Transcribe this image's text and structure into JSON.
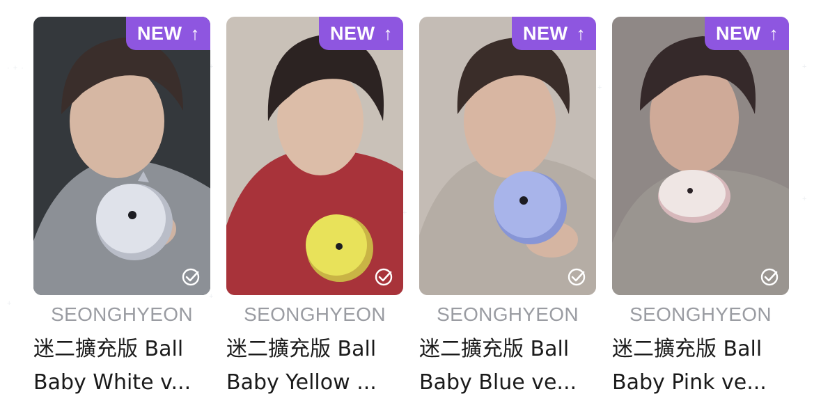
{
  "cards": [
    {
      "badge": "NEW",
      "member": "SEONGHYEON",
      "title_line1": "迷二擴充版 Ball",
      "title_line2": "Baby White v...",
      "colors": {
        "bg": "#34383c",
        "shirt": "#8c9096",
        "plush": "#dfe2ea",
        "plush_shadow": "#b9bdc8",
        "skin": "#d6b7a3",
        "hair": "#3a2e2b"
      }
    },
    {
      "badge": "NEW",
      "member": "SEONGHYEON",
      "title_line1": "迷二擴充版 Ball",
      "title_line2": "Baby Yellow ...",
      "colors": {
        "bg": "#c9c1b8",
        "shirt": "#a8333a",
        "plush": "#e8e25a",
        "plush_shadow": "#c9b445",
        "skin": "#dcbda8",
        "hair": "#2c2322"
      }
    },
    {
      "badge": "NEW",
      "member": "SEONGHYEON",
      "title_line1": "迷二擴充版 Ball",
      "title_line2": "Baby Blue ve...",
      "colors": {
        "bg": "#c4bcb5",
        "shirt": "#b5ada5",
        "plush": "#a8b4ea",
        "plush_shadow": "#8795d6",
        "skin": "#d8b6a2",
        "hair": "#3a2d29"
      }
    },
    {
      "badge": "NEW",
      "member": "SEONGHYEON",
      "title_line1": "迷二擴充版 Ball",
      "title_line2": "Baby Pink ve...",
      "colors": {
        "bg": "#8f8886",
        "shirt": "#9a9590",
        "plush": "#efe6e4",
        "plush_shadow": "#d7b8bb",
        "skin": "#cfaa98",
        "hair": "#35292a"
      }
    }
  ]
}
